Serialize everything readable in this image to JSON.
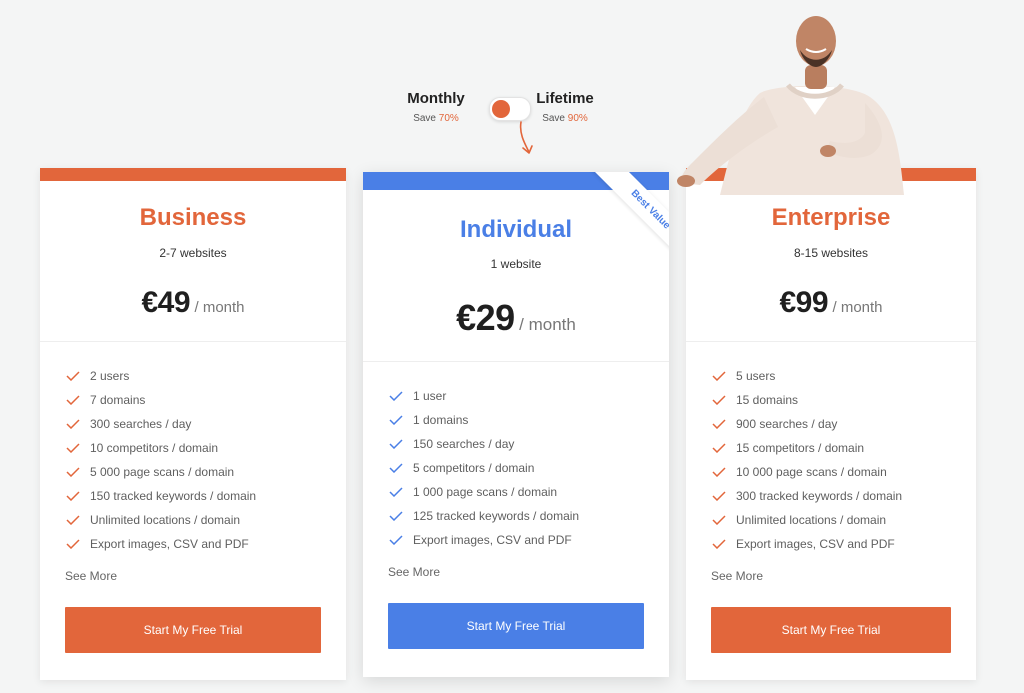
{
  "billing": {
    "monthly": {
      "label": "Monthly",
      "save_prefix": "Save",
      "save_pct": "70%"
    },
    "lifetime": {
      "label": "Lifetime",
      "save_prefix": "Save",
      "save_pct": "90%"
    },
    "selected": "Monthly"
  },
  "colors": {
    "orange": "#e2663b",
    "blue": "#4a7fe6"
  },
  "plans": [
    {
      "name": "Business",
      "subtitle": "2-7 websites",
      "price": "€49",
      "period": "/ month",
      "features": [
        "2 users",
        "7 domains",
        "300 searches / day",
        "10 competitors / domain",
        "5 000 page scans / domain",
        "150 tracked keywords / domain",
        "Unlimited locations / domain",
        "Export images, CSV and PDF"
      ],
      "see_more": "See More",
      "cta": "Start My Free Trial"
    },
    {
      "name": "Individual",
      "subtitle": "1 website",
      "price": "€29",
      "period": "/ month",
      "badge": "Best Value",
      "features": [
        "1 user",
        "1 domains",
        "150 searches / day",
        "5 competitors / domain",
        "1 000 page scans / domain",
        "125 tracked keywords / domain",
        "Export images, CSV and PDF"
      ],
      "see_more": "See More",
      "cta": "Start My Free Trial"
    },
    {
      "name": "Enterprise",
      "subtitle": "8-15 websites",
      "price": "€99",
      "period": "/ month",
      "features": [
        "5 users",
        "15 domains",
        "900 searches / day",
        "15 competitors / domain",
        "10 000 page scans / domain",
        "300 tracked keywords / domain",
        "Unlimited locations / domain",
        "Export images, CSV and PDF"
      ],
      "see_more": "See More",
      "cta": "Start My Free Trial"
    }
  ]
}
